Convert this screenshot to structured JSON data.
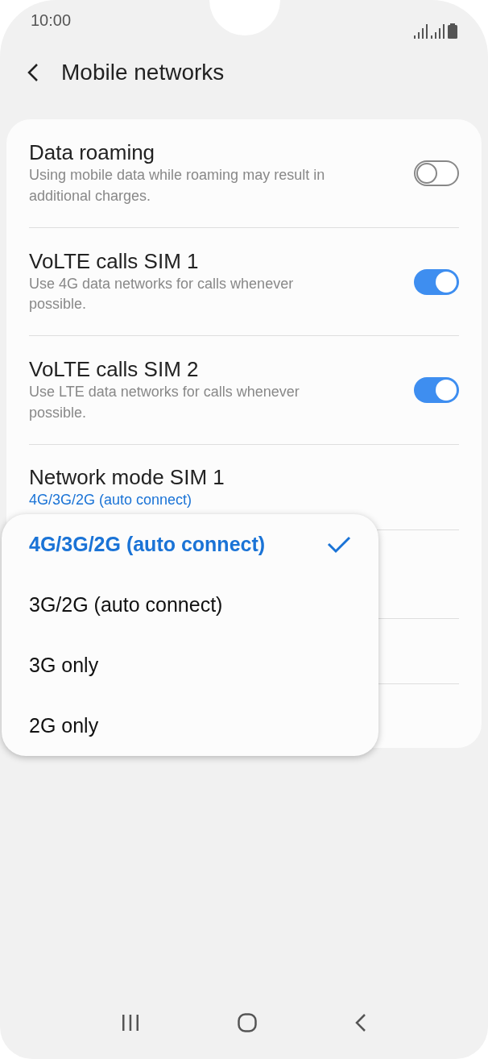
{
  "status_bar": {
    "time": "10:00"
  },
  "header": {
    "title": "Mobile networks"
  },
  "settings": [
    {
      "kind": "switch",
      "title": "Data roaming",
      "subtitle": "Using mobile data while roaming may result in additional charges.",
      "on": false
    },
    {
      "kind": "switch",
      "title": "VoLTE calls SIM 1",
      "subtitle": "Use 4G data networks for calls whenever possible.",
      "on": true
    },
    {
      "kind": "switch",
      "title": "VoLTE calls SIM 2",
      "subtitle": "Use LTE data networks for calls whenever possible.",
      "on": true
    },
    {
      "kind": "value",
      "title": "Network mode SIM 1",
      "value": "4G/3G/2G (auto connect)"
    }
  ],
  "popup": {
    "options": [
      {
        "label": "4G/3G/2G (auto connect)",
        "selected": true
      },
      {
        "label": "3G/2G (auto connect)",
        "selected": false
      },
      {
        "label": "3G only",
        "selected": false
      },
      {
        "label": "2G only",
        "selected": false
      }
    ]
  }
}
